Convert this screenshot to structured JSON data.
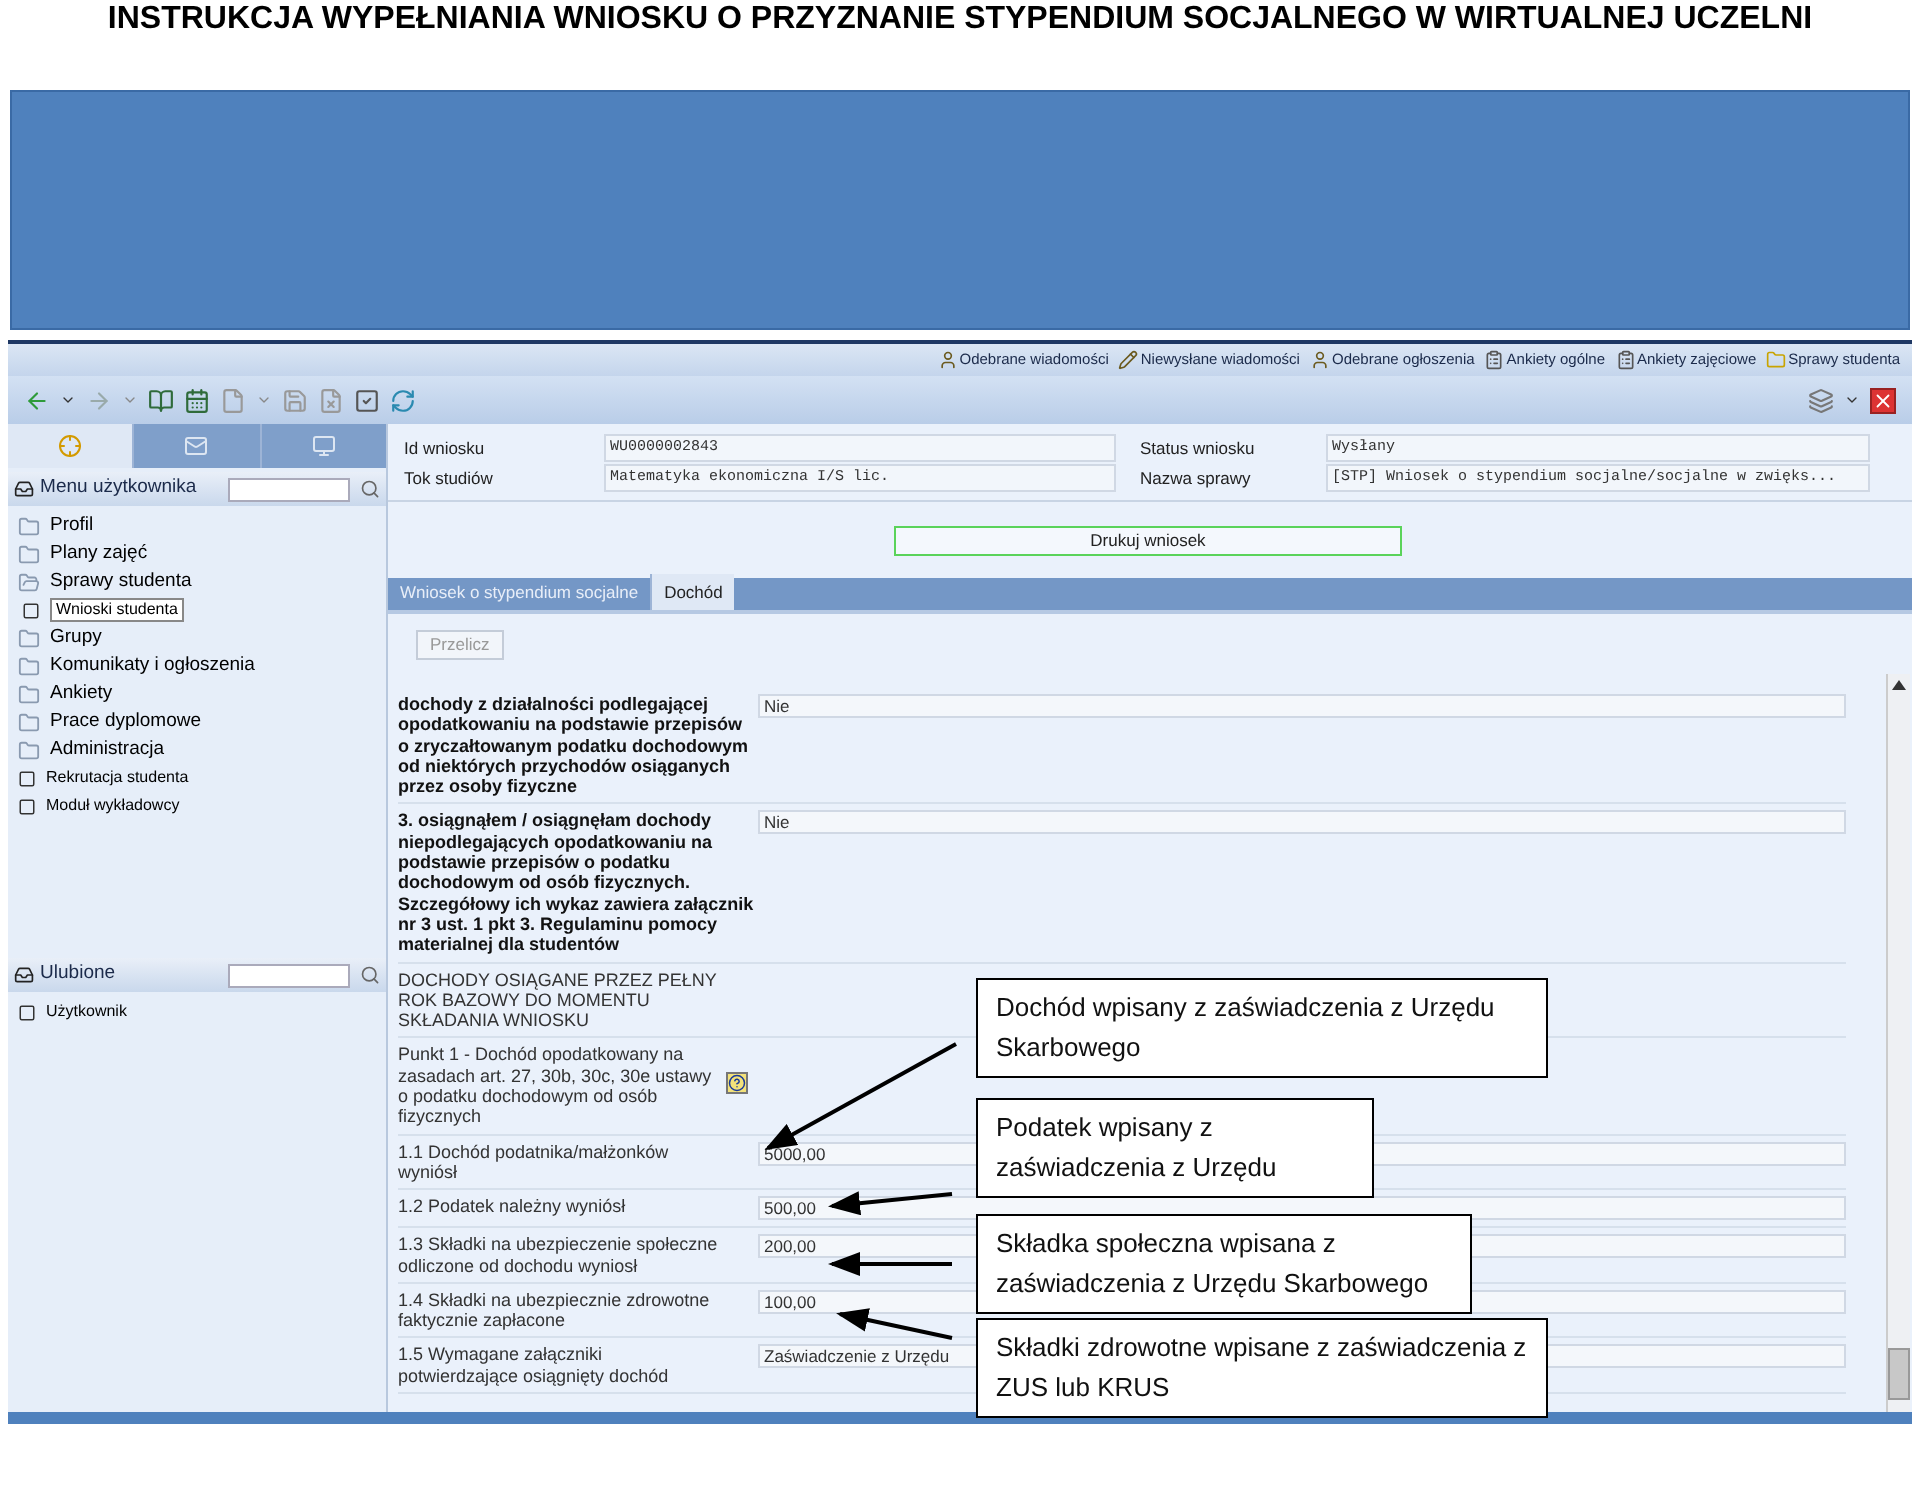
{
  "document_title": "INSTRUKCJA WYPEŁNIANIA WNIOSKU O PRZYZNANIE STYPENDIUM SOCJALNEGO  W WIRTUALNEJ UCZELNI",
  "top_links": [
    {
      "label": "Odebrane wiadomości",
      "kind": "person"
    },
    {
      "label": "Niewysłane wiadomości",
      "kind": "pencil"
    },
    {
      "label": "Odebrane ogłoszenia",
      "kind": "person"
    },
    {
      "label": "Ankiety ogólne",
      "kind": "clipboard"
    },
    {
      "label": "Ankiety zajęciowe",
      "kind": "clipboard"
    },
    {
      "label": "Sprawy studenta",
      "kind": "folder"
    }
  ],
  "sidebar_tabs": [
    {
      "selected": true
    },
    {
      "selected": false
    },
    {
      "selected": false
    }
  ],
  "menu": {
    "title": "Menu użytkownika",
    "items": [
      {
        "label": "Profil",
        "kind": "folder",
        "selected": false
      },
      {
        "label": "Plany zajęć",
        "kind": "folder",
        "selected": false
      },
      {
        "label": "Sprawy studenta",
        "kind": "folder",
        "selected": false,
        "children": [
          {
            "label": "Wnioski studenta",
            "kind": "page",
            "selected": true
          }
        ]
      },
      {
        "label": "Grupy",
        "kind": "folder",
        "selected": false
      },
      {
        "label": "Komunikaty i ogłoszenia",
        "kind": "folder",
        "selected": false
      },
      {
        "label": "Ankiety",
        "kind": "folder",
        "selected": false
      },
      {
        "label": "Prace dyplomowe",
        "kind": "folder",
        "selected": false
      },
      {
        "label": "Administracja",
        "kind": "folder",
        "selected": false
      },
      {
        "label": "Rekrutacja studenta",
        "kind": "page",
        "selected": false
      },
      {
        "label": "Moduł wykładowcy",
        "kind": "page",
        "selected": false
      }
    ]
  },
  "favorites": {
    "title": "Ulubione",
    "items": [
      {
        "label": "Użytkownik",
        "kind": "page",
        "selected": false
      }
    ]
  },
  "details": [
    {
      "label": "Id wniosku",
      "value": "WU0000002843"
    },
    {
      "label": "Status wniosku",
      "value": "Wysłany"
    },
    {
      "label": "Tok studiów",
      "value": "Matematyka ekonomiczna I/S lic."
    },
    {
      "label": "Nazwa sprawy",
      "value": "[STP] Wniosek o stypendium socjalne/socjalne w zwięks..."
    }
  ],
  "print_button": "Drukuj wniosek",
  "tabs": [
    {
      "label": "Wniosek o stypendium socjalne",
      "selected": false
    },
    {
      "label": "Dochód",
      "selected": true
    }
  ],
  "recalculate_button": {
    "label": "Przelicz",
    "disabled": true
  },
  "form_rows": [
    {
      "label": "dochody z działalności podlegającej opodatkowaniu na podstawie przepisów o zryczałtowanym podatku dochodowym od niektórych przychodów osiąganych przez osoby fizyczne",
      "value": "Nie",
      "bold": true,
      "help": false
    },
    {
      "label": "3. osiągnąłem / osiągnęłam dochody niepodlegających opodatkowaniu na podstawie przepisów o podatku dochodowym od osób fizycznych. Szczegółowy ich wykaz zawiera załącznik nr 3 ust. 1 pkt 3. Regulaminu pomocy materialnej dla studentów",
      "value": "Nie",
      "bold": true,
      "help": false
    },
    {
      "label": "DOCHODY OSIĄGANE PRZEZ PEŁNY ROK BAZOWY DO MOMENTU SKŁADANIA WNIOSKU",
      "bold": false,
      "help": false
    },
    {
      "label": "Punkt 1 - Dochód opodatkowany na zasadach art. 27, 30b, 30c, 30e ustawy o podatku dochodowym od osób fizycznych",
      "bold": false,
      "help": true
    },
    {
      "label": "1.1 Dochód podatnika/małżonków wyniósł",
      "value": "5000,00",
      "bold": false,
      "help": false
    },
    {
      "label": "1.2 Podatek należny wyniósł",
      "value": "500,00",
      "bold": false,
      "help": false
    },
    {
      "label": "1.3 Składki na ubezpieczenie społeczne odliczone od dochodu wyniosł",
      "value": "200,00",
      "bold": false,
      "help": false
    },
    {
      "label": "1.4 Składki na ubezpiecznie zdrowotne faktycznie zapłacone",
      "value": "100,00",
      "bold": false,
      "help": false
    },
    {
      "label": "1.5 Wymagane załączniki potwierdzające osiągnięty dochód",
      "value": "Zaświadczenie z Urzędu",
      "bold": false,
      "help": false
    }
  ],
  "callouts": [
    {
      "text": "Dochód wpisany z zaświadczenia z Urzędu Skarbowego"
    },
    {
      "text": "Podatek wpisany z zaświadczenia z Urzędu"
    },
    {
      "text": "Składka społeczna wpisana z zaświadczenia z Urzędu Skarbowego"
    },
    {
      "text": "Składki zdrowotne wpisane z zaświadczenia z ZUS lub KRUS"
    }
  ]
}
